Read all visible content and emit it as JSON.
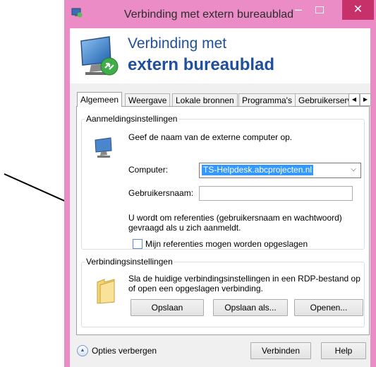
{
  "window": {
    "title": "Verbinding met extern bureaublad",
    "min_glyph": "–",
    "close_glyph": "✕",
    "title_color": "#ec8cc7",
    "close_color": "#c7316a"
  },
  "banner": {
    "line1": "Verbinding met",
    "line2": "extern bureaublad",
    "icon": "remote-desktop-icon"
  },
  "tabs": [
    {
      "label": "Algemeen",
      "active": true
    },
    {
      "label": "Weergave",
      "active": false
    },
    {
      "label": "Lokale bronnen",
      "active": false
    },
    {
      "label": "Programma's",
      "active": false
    },
    {
      "label": "Gebruikerserva",
      "active": false
    }
  ],
  "tab_scroll": {
    "left": "◀",
    "right": "▶"
  },
  "login": {
    "legend": "Aanmeldingsinstellingen",
    "description": "Geef de naam van de externe computer op.",
    "computer_label": "Computer:",
    "computer_value": "TS-Helpdesk.abcprojecten.nl",
    "username_label": "Gebruikersnaam:",
    "username_value": "",
    "info_line1": "U wordt om referenties (gebruikersnaam en wachtwoord)",
    "info_line2": "gevraagd als u zich aanmeldt.",
    "save_credentials_label": "Mijn referenties mogen worden opgeslagen",
    "save_credentials_checked": false
  },
  "connection": {
    "legend": "Verbindingsinstellingen",
    "line1": "Sla de huidige verbindingsinstellingen in een RDP-bestand op",
    "line2": "of open een opgeslagen verbinding.",
    "save": "Opslaan",
    "save_as": "Opslaan als...",
    "open": "Openen..."
  },
  "footer": {
    "toggle_label": "Opties verbergen",
    "connect": "Verbinden",
    "help": "Help"
  },
  "colors": {
    "accent": "#1f4f9e",
    "selection": "#3399ff"
  }
}
